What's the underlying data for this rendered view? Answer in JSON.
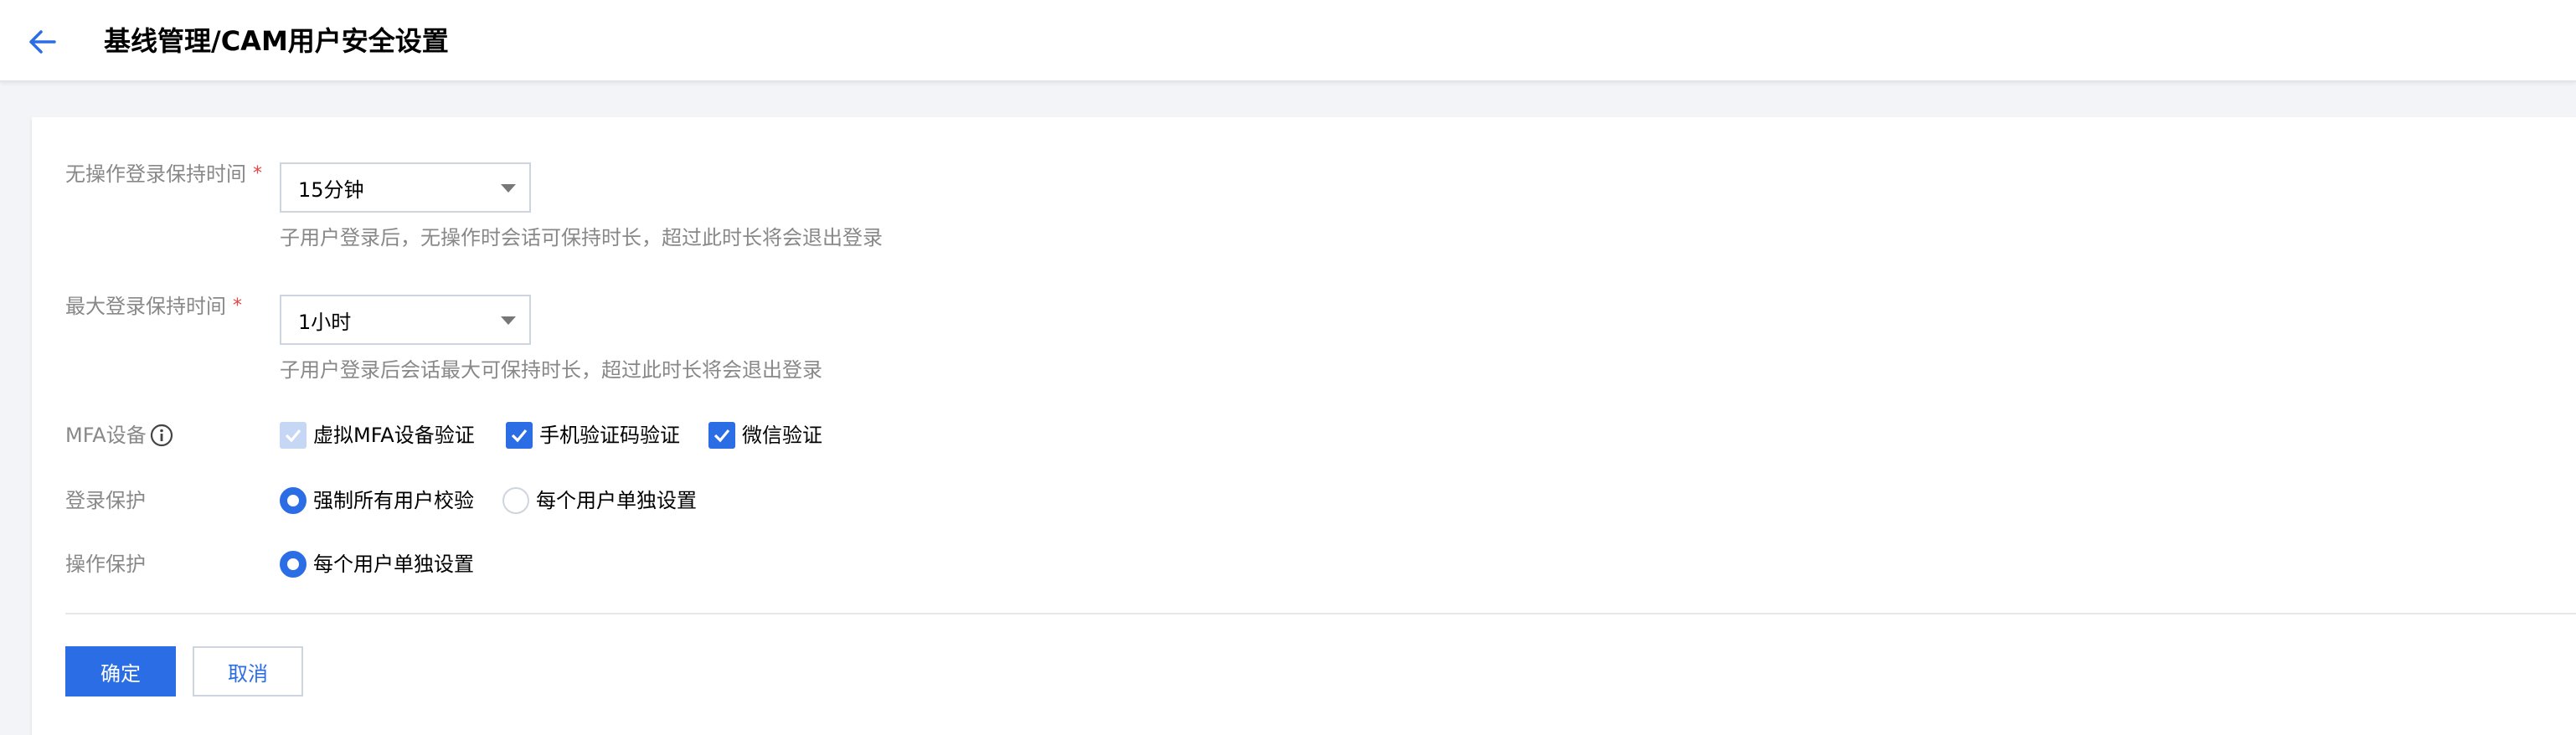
{
  "header": {
    "title": "基线管理/CAM用户安全设置"
  },
  "form": {
    "idle_timeout": {
      "label": "无操作登录保持时间",
      "required_mark": "*",
      "value": "15分钟",
      "hint": "子用户登录后，无操作时会话可保持时长，超过此时长将会退出登录"
    },
    "max_session": {
      "label": "最大登录保持时间",
      "required_mark": "*",
      "value": "1小时",
      "hint": "子用户登录后会话最大可保持时长，超过此时长将会退出登录"
    },
    "mfa": {
      "label": "MFA设备",
      "options": [
        {
          "label": "虚拟MFA设备验证",
          "checked": true,
          "disabled": true
        },
        {
          "label": "手机验证码验证",
          "checked": true,
          "disabled": false
        },
        {
          "label": "微信验证",
          "checked": true,
          "disabled": false
        }
      ]
    },
    "login_protection": {
      "label": "登录保护",
      "options": [
        {
          "label": "强制所有用户校验",
          "selected": true
        },
        {
          "label": "每个用户单独设置",
          "selected": false
        }
      ]
    },
    "operation_protection": {
      "label": "操作保护",
      "options": [
        {
          "label": "每个用户单独设置",
          "selected": true
        }
      ]
    }
  },
  "actions": {
    "confirm_label": "确定",
    "cancel_label": "取消"
  },
  "colors": {
    "primary": "#2b6de5",
    "required": "#e54545",
    "label_gray": "#888888",
    "checkbox_disabled": "#c5d7f5"
  },
  "icons": {
    "back": "arrow-left-icon",
    "caret": "caret-down-icon",
    "info": "info-circle-icon",
    "check": "check-icon"
  }
}
